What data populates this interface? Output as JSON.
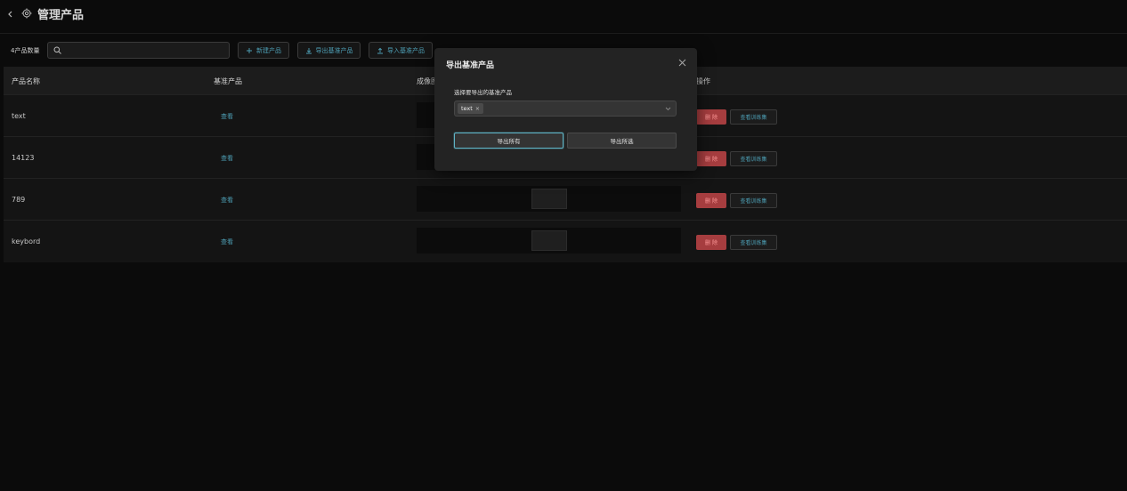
{
  "header": {
    "title": "管理产品"
  },
  "toolbar": {
    "count_label": "4产品数量",
    "search": {
      "value": "",
      "placeholder": ""
    },
    "buttons": [
      "新建产品",
      "导出基准产品",
      "导入基准产品"
    ]
  },
  "table": {
    "columns": [
      "产品名称",
      "基准产品",
      "成像图",
      "操作"
    ],
    "rows": [
      {
        "name": "text",
        "link": "查看",
        "delete": "删 除",
        "train": "查看训练集"
      },
      {
        "name": "14123",
        "link": "查看",
        "delete": "删 除",
        "train": "查看训练集"
      },
      {
        "name": "789",
        "link": "查看",
        "delete": "删 除",
        "train": "查看训练集"
      },
      {
        "name": "keybord",
        "link": "查看",
        "delete": "删 除",
        "train": "查看训练集"
      }
    ]
  },
  "modal": {
    "title": "导出基准产品",
    "field_label": "选择要导出的基准产品",
    "selected_tags": [
      "text"
    ],
    "tag_remove": "×",
    "buttons": {
      "export_all": "导出所有",
      "export_selected": "导出所选"
    }
  },
  "icons": {
    "back": "chevron-left-icon",
    "gear": "gear-icon",
    "search": "search-icon",
    "plus": "plus-icon",
    "download": "download-icon",
    "upload": "upload-icon",
    "close": "close-icon",
    "dropdown": "chevron-down-icon"
  },
  "colors": {
    "accent": "#4d9fb5",
    "danger": "#a63d3f",
    "background": "#0b0b0b",
    "modal": "#232323"
  }
}
